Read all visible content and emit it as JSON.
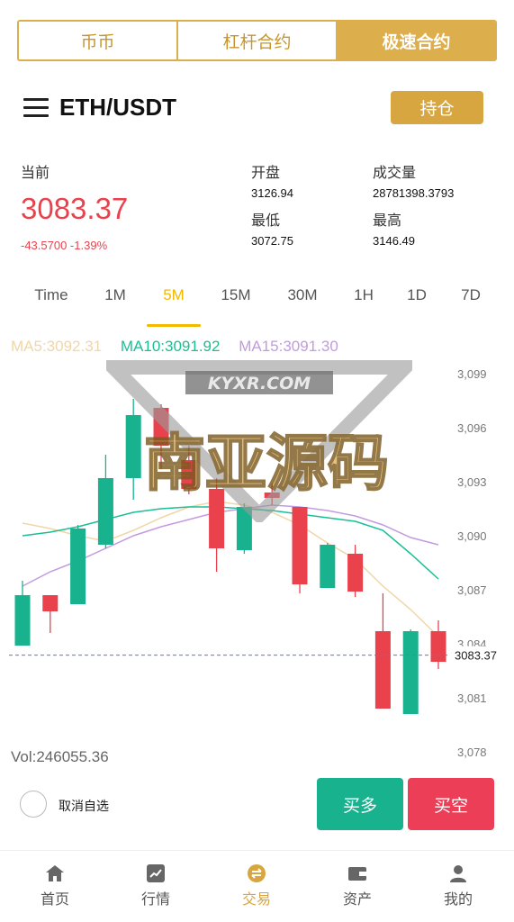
{
  "tabs": [
    {
      "label": "币币"
    },
    {
      "label": "杠杆合约"
    },
    {
      "label": "极速合约"
    }
  ],
  "header": {
    "pair": "ETH/USDT",
    "hold_label": "持仓"
  },
  "stats": {
    "current_label": "当前",
    "price": "3083.37",
    "change": "-43.5700 -1.39%",
    "open_label": "开盘",
    "open": "3126.94",
    "low_label": "最低",
    "low": "3072.75",
    "volume_label": "成交量",
    "volume": "28781398.3793",
    "high_label": "最高",
    "high": "3146.49"
  },
  "intervals": [
    "Time",
    "1M",
    "5M",
    "15M",
    "30M",
    "1H",
    "1D",
    "7D"
  ],
  "active_interval": "5M",
  "ma": {
    "ma5": "MA5:3092.31",
    "ma10": "MA10:3091.92",
    "ma15": "MA15:3091.30"
  },
  "colors": {
    "up": "#18b38e",
    "down": "#e9424d",
    "ma5": "#f0d6a8",
    "ma10": "#1abf94",
    "ma15": "#c39be0",
    "accent": "#dcae4c"
  },
  "chart_data": {
    "type": "candlestick",
    "y_ticks": [
      3099,
      3096,
      3093,
      3090,
      3087,
      3084,
      3081,
      3078
    ],
    "y_tick_labels": [
      "3,099",
      "3,096",
      "3,093",
      "3,090",
      "3,087",
      "3,084",
      "3,081",
      "3,078"
    ],
    "ylim": [
      3078,
      3099
    ],
    "current_price": 3083.37,
    "current_label": "3083.37",
    "candles": [
      {
        "o": 3083.9,
        "c": 3086.7,
        "h": 3087.5,
        "l": 3083.9
      },
      {
        "o": 3086.7,
        "c": 3085.8,
        "h": 3086.7,
        "l": 3084.6
      },
      {
        "o": 3086.2,
        "c": 3090.4,
        "h": 3090.6,
        "l": 3086.2
      },
      {
        "o": 3089.5,
        "c": 3093.2,
        "h": 3094.5,
        "l": 3089.3
      },
      {
        "o": 3093.2,
        "c": 3096.7,
        "h": 3097.6,
        "l": 3092.0
      },
      {
        "o": 3097.1,
        "c": 3095.0,
        "h": 3097.3,
        "l": 3093.7
      },
      {
        "o": 3094.2,
        "c": 3092.6,
        "h": 3095.0,
        "l": 3092.3
      },
      {
        "o": 3092.6,
        "c": 3089.3,
        "h": 3093.2,
        "l": 3088.0
      },
      {
        "o": 3089.2,
        "c": 3091.6,
        "h": 3091.8,
        "l": 3089.0
      },
      {
        "o": 3092.4,
        "c": 3092.1,
        "h": 3092.9,
        "l": 3091.7
      },
      {
        "o": 3091.6,
        "c": 3087.3,
        "h": 3091.6,
        "l": 3086.8
      },
      {
        "o": 3087.1,
        "c": 3089.5,
        "h": 3089.6,
        "l": 3087.1
      },
      {
        "o": 3089.0,
        "c": 3086.9,
        "h": 3089.5,
        "l": 3086.6
      },
      {
        "o": 3084.7,
        "c": 3080.4,
        "h": 3086.8,
        "l": 3080.4
      },
      {
        "o": 3080.1,
        "c": 3084.7,
        "h": 3084.8,
        "l": 3080.1
      },
      {
        "o": 3084.7,
        "c": 3083.0,
        "h": 3085.3,
        "l": 3082.6
      }
    ],
    "ma5_line": [
      3090.7,
      3090.4,
      3090.0,
      3089.7,
      3090.3,
      3091.0,
      3091.6,
      3091.9,
      3091.7,
      3091.3,
      3090.6,
      3089.6,
      3088.7,
      3087.2,
      3085.9,
      3084.4
    ],
    "ma10_line": [
      3090.0,
      3090.2,
      3090.5,
      3090.9,
      3091.3,
      3091.5,
      3091.6,
      3091.6,
      3091.5,
      3091.4,
      3091.2,
      3091.0,
      3090.8,
      3090.3,
      3089.0,
      3087.6
    ],
    "ma15_line": [
      3087.2,
      3088.0,
      3088.6,
      3089.3,
      3090.0,
      3090.5,
      3090.9,
      3091.3,
      3091.5,
      3091.7,
      3091.6,
      3091.4,
      3091.1,
      3090.6,
      3089.9,
      3089.5
    ]
  },
  "volume_label": "Vol:246055.36",
  "actions": {
    "cancel_watch": "取消自选",
    "buy": "买多",
    "sell": "买空"
  },
  "nav": [
    {
      "label": "首页",
      "icon": "home-icon"
    },
    {
      "label": "行情",
      "icon": "chart-icon"
    },
    {
      "label": "交易",
      "icon": "swap-icon"
    },
    {
      "label": "资产",
      "icon": "wallet-icon"
    },
    {
      "label": "我的",
      "icon": "user-icon"
    }
  ],
  "watermark": {
    "top": "KYXR.COM",
    "main": "南亚源码"
  }
}
